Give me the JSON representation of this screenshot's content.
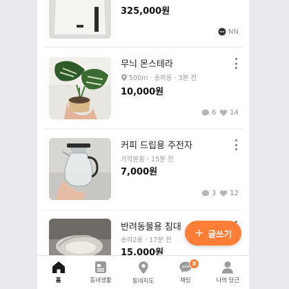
{
  "colors": {
    "accent": "#ff7e36",
    "text": "#222222",
    "muted": "#9a9a9a"
  },
  "items": [
    {
      "title": "",
      "location": "",
      "price": "325,000원",
      "stats": {
        "seller_badge": "NN"
      }
    },
    {
      "title": "무늬 몬스테라",
      "location": "500m · 송파동 · 3분 전",
      "price": "10,000원",
      "stats": {
        "chats": "6",
        "likes": "14"
      }
    },
    {
      "title": "커피 드립용 주전자",
      "location": "가락본동 · 15분 전",
      "price": "7,000원",
      "stats": {
        "chats": "3",
        "likes": "12"
      }
    },
    {
      "title": "반려동물용 침대",
      "location": "송파2동 · 17분 전",
      "price": "15,000원"
    }
  ],
  "fab": {
    "label": "글쓰기"
  },
  "tabbar": {
    "items": [
      {
        "label": "홈",
        "icon": "home-icon"
      },
      {
        "label": "동네생활",
        "icon": "feed-icon"
      },
      {
        "label": "동네지도",
        "icon": "map-pin-icon"
      },
      {
        "label": "채팅",
        "icon": "chat-icon",
        "badge": "8"
      },
      {
        "label": "나의 당근",
        "icon": "user-icon"
      }
    ]
  }
}
